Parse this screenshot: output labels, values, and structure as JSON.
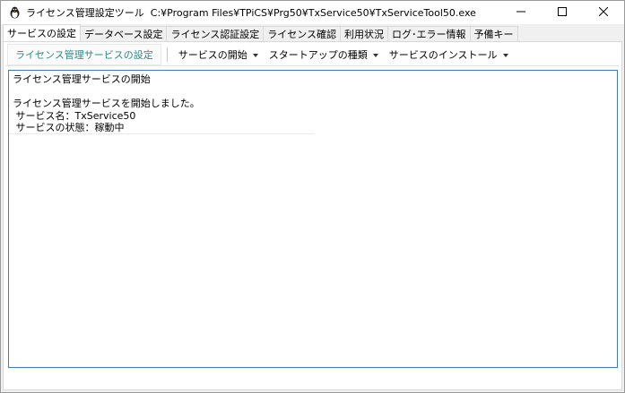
{
  "window": {
    "title": "ライセンス管理設定ツール",
    "path": "C:¥Program Files¥TPiCS¥Prg50¥TxService50¥TxServiceTool50.exe",
    "icon": "penguin-app-icon",
    "controls": {
      "minimize": "minimize-icon",
      "maximize": "maximize-icon",
      "close": "close-icon"
    }
  },
  "tabs": [
    {
      "label": "サービスの設定",
      "active": true
    },
    {
      "label": "データベース設定",
      "active": false
    },
    {
      "label": "ライセンス認証設定",
      "active": false
    },
    {
      "label": "ライセンス確認",
      "active": false
    },
    {
      "label": "利用状況",
      "active": false
    },
    {
      "label": "ログ･エラー情報",
      "active": false
    },
    {
      "label": "予備キー",
      "active": false
    }
  ],
  "toolbar": {
    "manage_label": "ライセンス管理サービスの設定",
    "start_label": "サービスの開始",
    "startup_type_label": "スタートアップの種類",
    "install_label": "サービスのインストール"
  },
  "log": {
    "lines": [
      "ライセンス管理サービスの開始",
      "",
      "ライセンス管理サービスを開始しました。",
      " サービス名：TxService50",
      " サービスの状態：稼動中"
    ]
  },
  "colors": {
    "accent": "#2b8a8a",
    "log_border": "#3c7fb1",
    "window_bg": "#f0f0f0"
  }
}
